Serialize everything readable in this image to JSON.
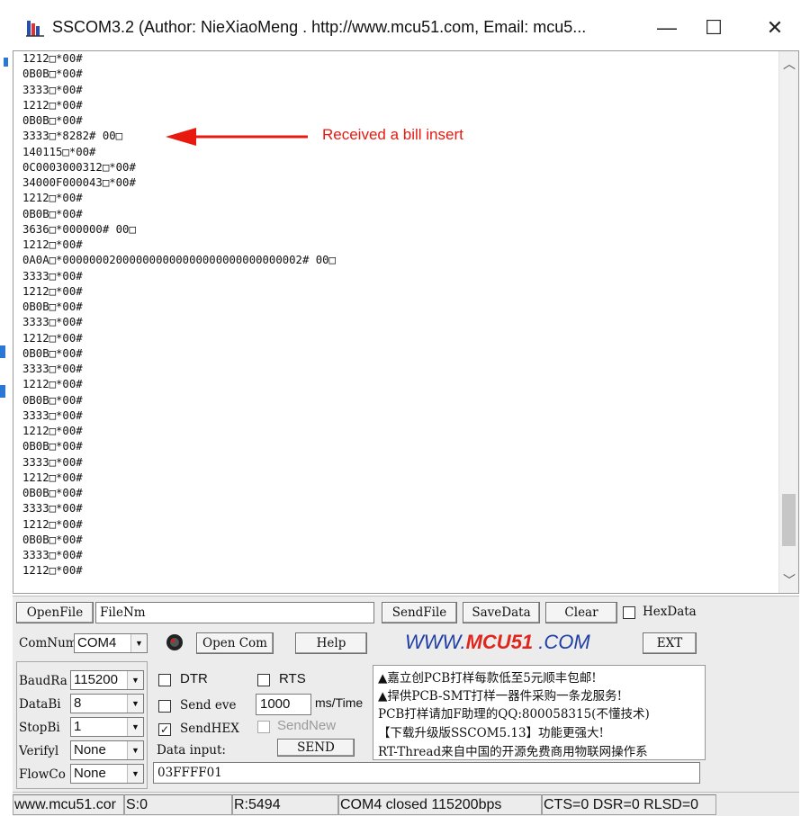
{
  "window": {
    "title": "SSCOM3.2 (Author: NieXiaoMeng .  http://www.mcu51.com,  Email: mcu5...",
    "minimize_glyph": "—",
    "maximize_glyph": "☐",
    "close_glyph": "✕"
  },
  "receive_area": {
    "lines": [
      "1212□*00#",
      "0B0B□*00#",
      "3333□*00#",
      "1212□*00#",
      "0B0B□*00#",
      "3333□*8282# 00□",
      "140115□*00#",
      "0C0003000312□*00#",
      "34000F000043□*00#",
      "1212□*00#",
      "0B0B□*00#",
      "3636□*000000# 00□",
      "1212□*00#",
      "0A0A□*000000020000000000000000000000000002# 00□",
      "3333□*00#",
      "1212□*00#",
      "0B0B□*00#",
      "3333□*00#",
      "1212□*00#",
      "0B0B□*00#",
      "3333□*00#",
      "1212□*00#",
      "0B0B□*00#",
      "3333□*00#",
      "1212□*00#",
      "0B0B□*00#",
      "3333□*00#",
      "1212□*00#",
      "0B0B□*00#",
      "3333□*00#",
      "1212□*00#",
      "0B0B□*00#",
      "3333□*00#",
      "1212□*00#"
    ],
    "scroll_up_glyph": "︿",
    "scroll_down_glyph": "﹀"
  },
  "annotation": {
    "text": "Received a bill insert",
    "color": "#e8190f"
  },
  "toolbar": {
    "open_file": "OpenFile",
    "file_name": "FileNm",
    "send_file": "SendFile",
    "save_data": "SaveData",
    "clear": "Clear",
    "hex_data": "HexData",
    "com_num_label": "ComNum",
    "com_port": "COM4",
    "open_com": "Open Com",
    "help": "Help",
    "logo_left": "WWW.",
    "logo_mid": "MCU51",
    "logo_right": " .COM",
    "ext": "EXT"
  },
  "params": {
    "baud_label": "BaudRa",
    "baud_value": "115200",
    "databits_label": "DataBi",
    "databits_value": "8",
    "stopbits_label": "StopBi",
    "stopbits_value": "1",
    "verify_label": "Verifyl",
    "verify_value": "None",
    "flow_label": "FlowCo",
    "flow_value": "None"
  },
  "options": {
    "dtr": "DTR",
    "rts": "RTS",
    "send_every": "Send eve",
    "interval_value": "1000",
    "interval_unit": "ms/Time",
    "send_hex": "SendHEX",
    "send_new": "SendNew",
    "data_input_label": "Data input:",
    "send_button": "SEND",
    "data_input_value": "03FFFF01"
  },
  "ad": {
    "lines": [
      "▲嘉立创PCB打样每款低至5元顺丰包邮!",
      "▲捍供PCB-SMT打样一器件采购一条龙服务!",
      "PCB打样请加F助理的QQ:800058315(不懂技术)",
      "【下载升级版SSCOM5.13】功能更强大!",
      "RT-Thread来自中国的开源免费商用物联网操作系"
    ]
  },
  "status": {
    "url": "www.mcu51.cor",
    "sent": "S:0",
    "received": "R:5494",
    "port_state": "COM4 closed  115200bps",
    "lines_state": "CTS=0 DSR=0 RLSD=0"
  },
  "colors": {
    "accent_blue": "#1f3fa5",
    "accent_red": "#e0261c",
    "panel_bg": "#ececec"
  }
}
